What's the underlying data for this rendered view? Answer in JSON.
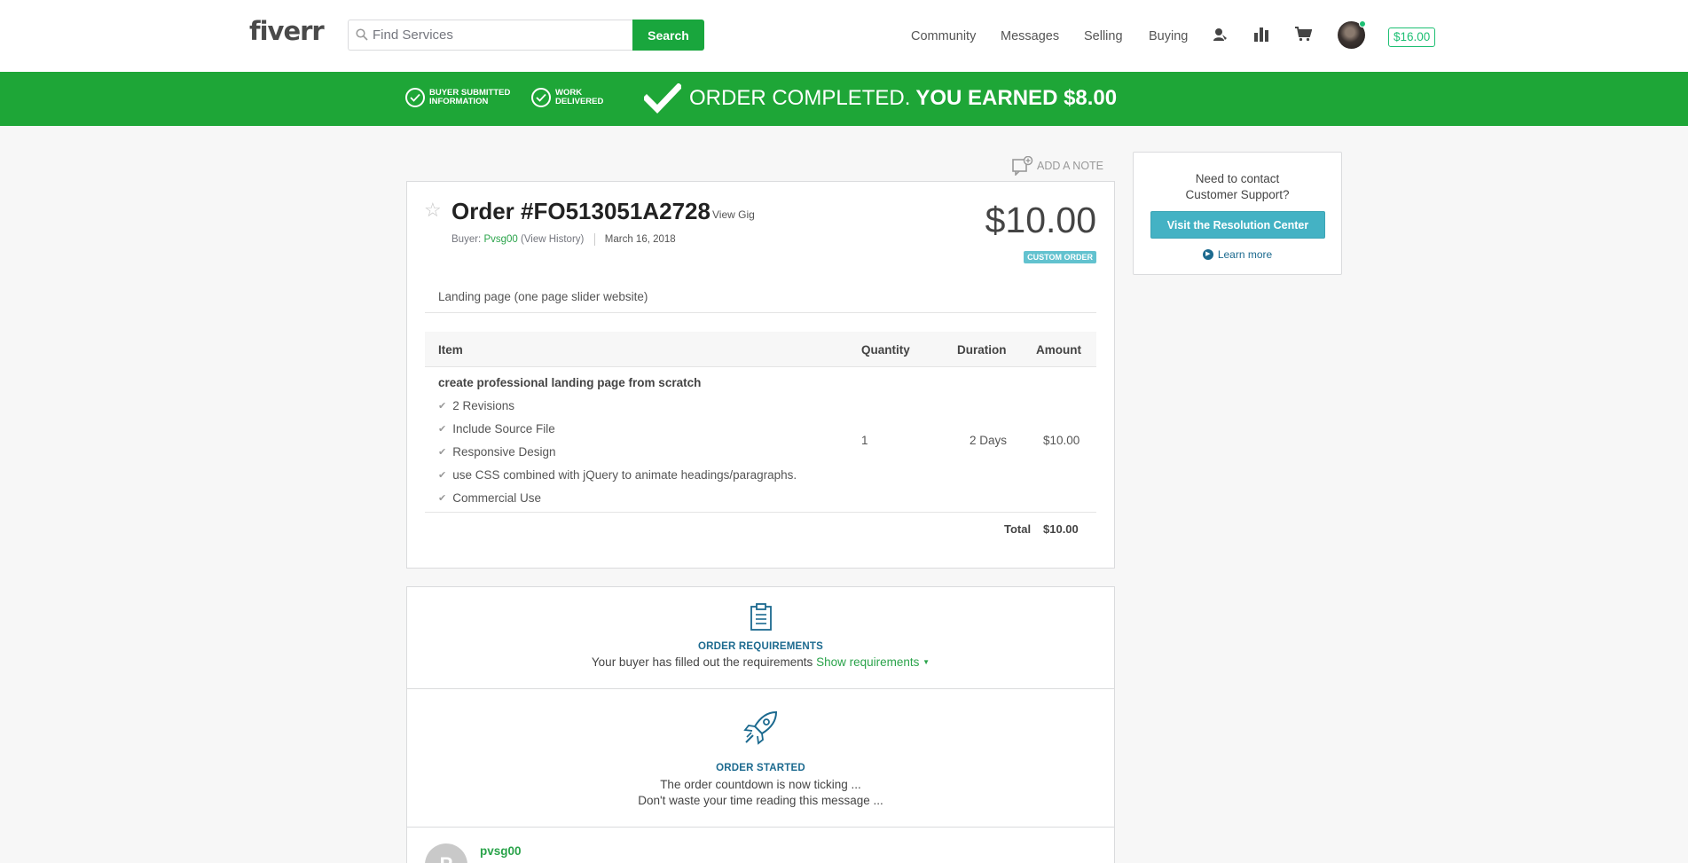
{
  "header": {
    "logo": "fiverr",
    "search_placeholder": "Find Services",
    "search_button": "Search",
    "nav": [
      "Community",
      "Messages",
      "Selling",
      "Buying"
    ],
    "icons": [
      "agent-icon",
      "stats-icon",
      "cart-icon"
    ],
    "balance": "$16.00"
  },
  "banner": {
    "step1": [
      "BUYER SUBMITTED",
      "INFORMATION"
    ],
    "step2": [
      "WORK",
      "DELIVERED"
    ],
    "title_main": "ORDER COMPLETED.",
    "title_earned": "YOU EARNED $8.00"
  },
  "add_note": "ADD A NOTE",
  "order": {
    "title": "Order #FO513051A2728",
    "view_gig": "View Gig",
    "buyer_label": "Buyer:",
    "buyer_name": "Pvsg00",
    "view_history": "View History",
    "date": "March 16, 2018",
    "price": "$10.00",
    "badge": "CUSTOM ORDER",
    "description": "Landing page (one page slider website)",
    "table": {
      "headers": [
        "Item",
        "Quantity",
        "Duration",
        "Amount"
      ],
      "item_title": "create professional landing page from scratch",
      "features": [
        "2 Revisions",
        "Include Source File",
        "Responsive Design",
        "use CSS combined with jQuery to animate headings/paragraphs.",
        "Commercial Use"
      ],
      "quantity": "1",
      "duration": "2 Days",
      "amount": "$10.00",
      "total_label": "Total",
      "total_value": "$10.00"
    }
  },
  "requirements": {
    "title": "ORDER REQUIREMENTS",
    "text": "Your buyer has filled out the requirements",
    "link": "Show requirements"
  },
  "started": {
    "title": "ORDER STARTED",
    "line1": "The order countdown is now ticking ...",
    "line2": "Don't waste your time reading this message ..."
  },
  "message": {
    "avatar_letter": "P",
    "username": "pvsg00"
  },
  "support": {
    "line1": "Need to contact",
    "line2": "Customer Support?",
    "button": "Visit the Resolution Center",
    "learn_more": "Learn more"
  },
  "colors": {
    "brand_green": "#1ea637",
    "link_blue": "#1c6a8f",
    "teal_button": "#44b2c4"
  }
}
